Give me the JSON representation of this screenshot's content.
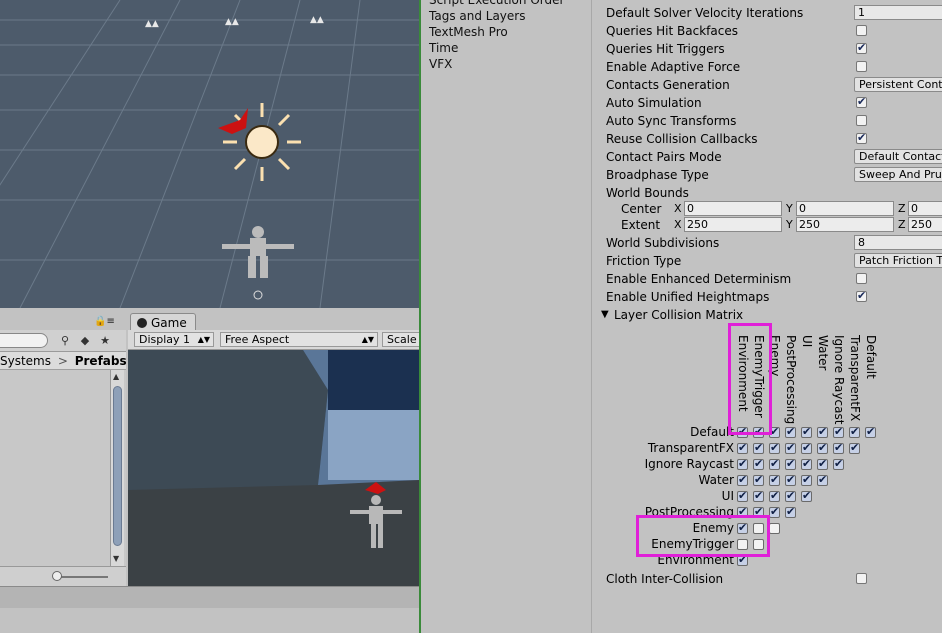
{
  "scene": {
    "name": "scene-view"
  },
  "game_tab": {
    "label": "Game"
  },
  "game_toolbar": {
    "display": "Display 1",
    "aspect": "Free Aspect",
    "scale": "Scale"
  },
  "project": {
    "breadcrumb_prev": "Systems",
    "breadcrumb_sep": ">",
    "breadcrumb_current": "Prefabs"
  },
  "settings_list": [
    "Script Execution Order",
    "Tags and Layers",
    "TextMesh Pro",
    "Time",
    "VFX"
  ],
  "physics": {
    "velocity_iterations_label": "Default Solver Velocity Iterations",
    "velocity_iterations": "1",
    "hit_backfaces": "Queries Hit Backfaces",
    "hit_triggers": "Queries Hit Triggers",
    "adaptive_force": "Enable Adaptive Force",
    "contacts_generation_label": "Contacts Generation",
    "contacts_generation": "Persistent Contacts",
    "auto_simulation": "Auto Simulation",
    "auto_sync": "Auto Sync Transforms",
    "reuse_callbacks": "Reuse Collision Callbacks",
    "contact_pairs_label": "Contact Pairs Mode",
    "contact_pairs": "Default Contact Pairs",
    "broadphase_label": "Broadphase Type",
    "broadphase": "Sweep And Prune Broadphase",
    "world_bounds": "World Bounds",
    "center_label": "Center",
    "extent_label": "Extent",
    "x": "X",
    "y": "Y",
    "z": "Z",
    "center": [
      "0",
      "0",
      "0"
    ],
    "extent": [
      "250",
      "250",
      "250"
    ],
    "subdivisions_label": "World Subdivisions",
    "subdivisions": "8",
    "friction_label": "Friction Type",
    "friction": "Patch Friction Type",
    "determinism": "Enable Enhanced Determinism",
    "heightmaps": "Enable Unified Heightmaps",
    "matrix_title": "Layer Collision Matrix",
    "cloth": "Cloth Inter-Collision"
  },
  "matrix": {
    "columns": [
      "Environment",
      "EnemyTrigger",
      "Enemy",
      "PostProcessing",
      "UI",
      "Water",
      "Ignore Raycast",
      "TransparentFX",
      "Default"
    ],
    "rows": [
      "Default",
      "TransparentFX",
      "Ignore Raycast",
      "Water",
      "UI",
      "PostProcessing",
      "Enemy",
      "EnemyTrigger",
      "Environment"
    ],
    "checked": [
      [
        true,
        true,
        true,
        true,
        true,
        true,
        true,
        true,
        true
      ],
      [
        true,
        true,
        true,
        true,
        true,
        true,
        true,
        true
      ],
      [
        true,
        true,
        true,
        true,
        true,
        true,
        true
      ],
      [
        true,
        true,
        true,
        true,
        true,
        true
      ],
      [
        true,
        true,
        true,
        true,
        true
      ],
      [
        true,
        true,
        true,
        true
      ],
      [
        true,
        false,
        false
      ],
      [
        false,
        false
      ],
      [
        true
      ]
    ]
  },
  "accent": {
    "highlight": "#e020d8",
    "check": "#0e1e44"
  }
}
